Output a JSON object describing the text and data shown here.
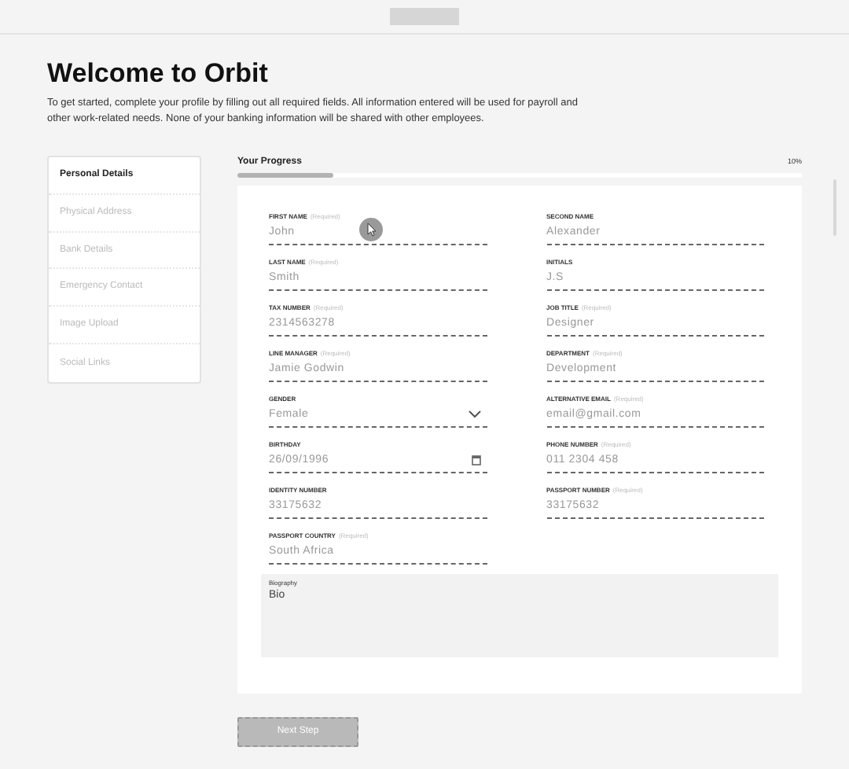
{
  "header": {
    "title": "Welcome to Orbit",
    "intro": "To get started, complete your profile by filling out all required fields. All information entered will be used for payroll and other work-related needs. None of your banking information will be shared with other employees."
  },
  "sidebar": {
    "items": [
      {
        "label": "Personal Details",
        "selected": true
      },
      {
        "label": "Physical Address",
        "selected": false
      },
      {
        "label": "Bank Details",
        "selected": false
      },
      {
        "label": "Emergency Contact",
        "selected": false
      },
      {
        "label": "Image Upload",
        "selected": false
      },
      {
        "label": "Social Links",
        "selected": false
      }
    ]
  },
  "progress": {
    "label": "Your Progress",
    "reading": "10%",
    "level": 0.17
  },
  "form": {
    "fields": [
      {
        "label": "FIRST NAME",
        "note": "(Required)",
        "value": "John",
        "kind": "text"
      },
      {
        "label": "SECOND NAME",
        "value": "Alexander",
        "kind": "text"
      },
      {
        "label": "LAST NAME",
        "note": "(Required)",
        "value": "Smith",
        "kind": "text"
      },
      {
        "label": "INITIALS",
        "value": "J.S",
        "kind": "text"
      },
      {
        "label": "TAX NUMBER",
        "note": "(Required)",
        "value": "2314563278",
        "kind": "text"
      },
      {
        "label": "JOB TITLE",
        "note": "(Required)",
        "value": "Designer",
        "kind": "text"
      },
      {
        "label": "LINE MANAGER",
        "note": "(Required)",
        "value": "Jamie Godwin",
        "kind": "text"
      },
      {
        "label": "DEPARTMENT",
        "note": "(Required)",
        "value": "Development",
        "kind": "text"
      },
      {
        "label": "GENDER",
        "value": "Female",
        "kind": "select"
      },
      {
        "label": "ALTERNATIVE EMAIL",
        "note": "(Required)",
        "value": "email@gmail.com",
        "kind": "text"
      },
      {
        "label": "BIRTHDAY",
        "value": "26/09/1996",
        "kind": "date"
      },
      {
        "label": "PHONE NUMBER",
        "note": "(Required)",
        "value": "011 2304 458",
        "kind": "text"
      },
      {
        "label": "IDENTITY NUMBER",
        "value": "33175632",
        "kind": "text"
      },
      {
        "label": "PASSPORT NUMBER",
        "note": "(Required)",
        "value": "33175632",
        "kind": "text"
      },
      {
        "label": "PASSPORT COUNTRY",
        "note": "(Required)",
        "value": "South Africa",
        "kind": "text"
      }
    ],
    "biography": {
      "label": "Biography",
      "value": "Bio"
    }
  },
  "next_button": "Next Step"
}
